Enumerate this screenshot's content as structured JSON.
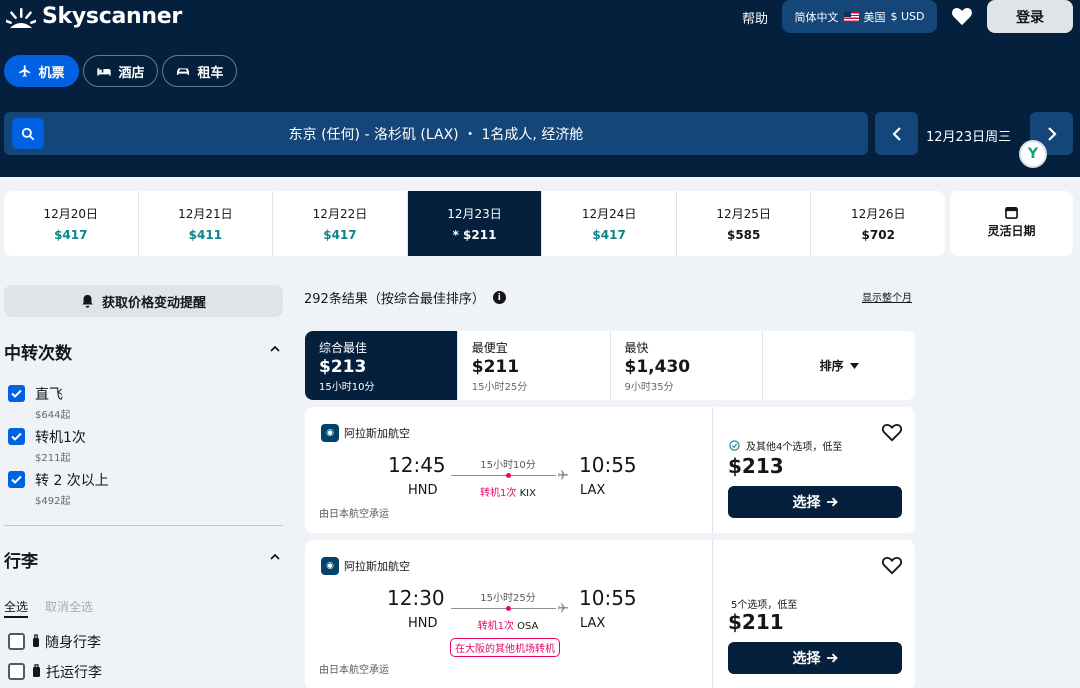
{
  "header": {
    "logo_text": "Skyscanner",
    "help": "帮助",
    "language": "简体中文",
    "region": "美国",
    "currency": "$ USD",
    "login": "登录"
  },
  "tabs": [
    {
      "label": "机票",
      "icon": "plane-icon",
      "active": true
    },
    {
      "label": "酒店",
      "icon": "bed-icon",
      "active": false
    },
    {
      "label": "租车",
      "icon": "car-icon",
      "active": false
    }
  ],
  "search": {
    "summary": "东京 (任何) - 洛杉矶 (LAX)  ・ 1名成人, 经济舱",
    "date": "12月23日周三",
    "badge": "Y"
  },
  "date_strip": [
    {
      "date": "12月20日",
      "price": "$417",
      "green": true
    },
    {
      "date": "12月21日",
      "price": "$411",
      "green": true
    },
    {
      "date": "12月22日",
      "price": "$417",
      "green": true
    },
    {
      "date": "12月23日",
      "price": "* $211",
      "green": false,
      "active": true
    },
    {
      "date": "12月24日",
      "price": "$417",
      "green": true
    },
    {
      "date": "12月25日",
      "price": "$585",
      "green": false
    },
    {
      "date": "12月26日",
      "price": "$702",
      "green": false
    }
  ],
  "flexible_dates": "灵活日期",
  "sidebar": {
    "price_alert": "获取价格变动提醒",
    "stops_title": "中转次数",
    "stops": [
      {
        "label": "直飞",
        "sub": "$644起",
        "checked": true
      },
      {
        "label": "转机1次",
        "sub": "$211起",
        "checked": true
      },
      {
        "label": "转 2 次以上",
        "sub": "$492起",
        "checked": true
      }
    ],
    "baggage_title": "行李",
    "select_all": "全选",
    "deselect_all": "取消全选",
    "baggage": [
      {
        "label": "随身行李",
        "checked": false
      },
      {
        "label": "托运行李",
        "checked": false
      }
    ]
  },
  "results": {
    "count_text": "292条结果（按综合最佳排序）",
    "show_month": "显示整个月"
  },
  "sort_tabs": [
    {
      "label": "综合最佳",
      "price": "$213",
      "duration": "15小时10分",
      "active": true
    },
    {
      "label": "最便宜",
      "price": "$211",
      "duration": "15小时25分",
      "active": false
    },
    {
      "label": "最快",
      "price": "$1,430",
      "duration": "9小时35分",
      "active": false
    }
  ],
  "sort_dropdown": "排序",
  "cards": [
    {
      "airline": "阿拉斯加航空",
      "dep_time": "12:45",
      "dep_airport": "HND",
      "duration": "15小时10分",
      "stops": "转机1次",
      "via": "KIX",
      "arr_time": "10:55",
      "arr_airport": "LAX",
      "operated_by": "由日本航空承运",
      "other_options": "及其他4个选项，低至",
      "price": "$213",
      "select": "选择",
      "warning": ""
    },
    {
      "airline": "阿拉斯加航空",
      "dep_time": "12:30",
      "dep_airport": "HND",
      "duration": "15小时25分",
      "stops": "转机1次",
      "via": "OSA",
      "arr_time": "10:55",
      "arr_airport": "LAX",
      "operated_by": "由日本航空承运",
      "other_options": "5个选项，低至",
      "price": "$211",
      "select": "选择",
      "warning": "在大阪的其他机场转机"
    }
  ],
  "colors": {
    "navy": "#05203c",
    "blue": "#0062e3",
    "teal_price": "#0c838a",
    "stop_pink": "#e70866"
  }
}
